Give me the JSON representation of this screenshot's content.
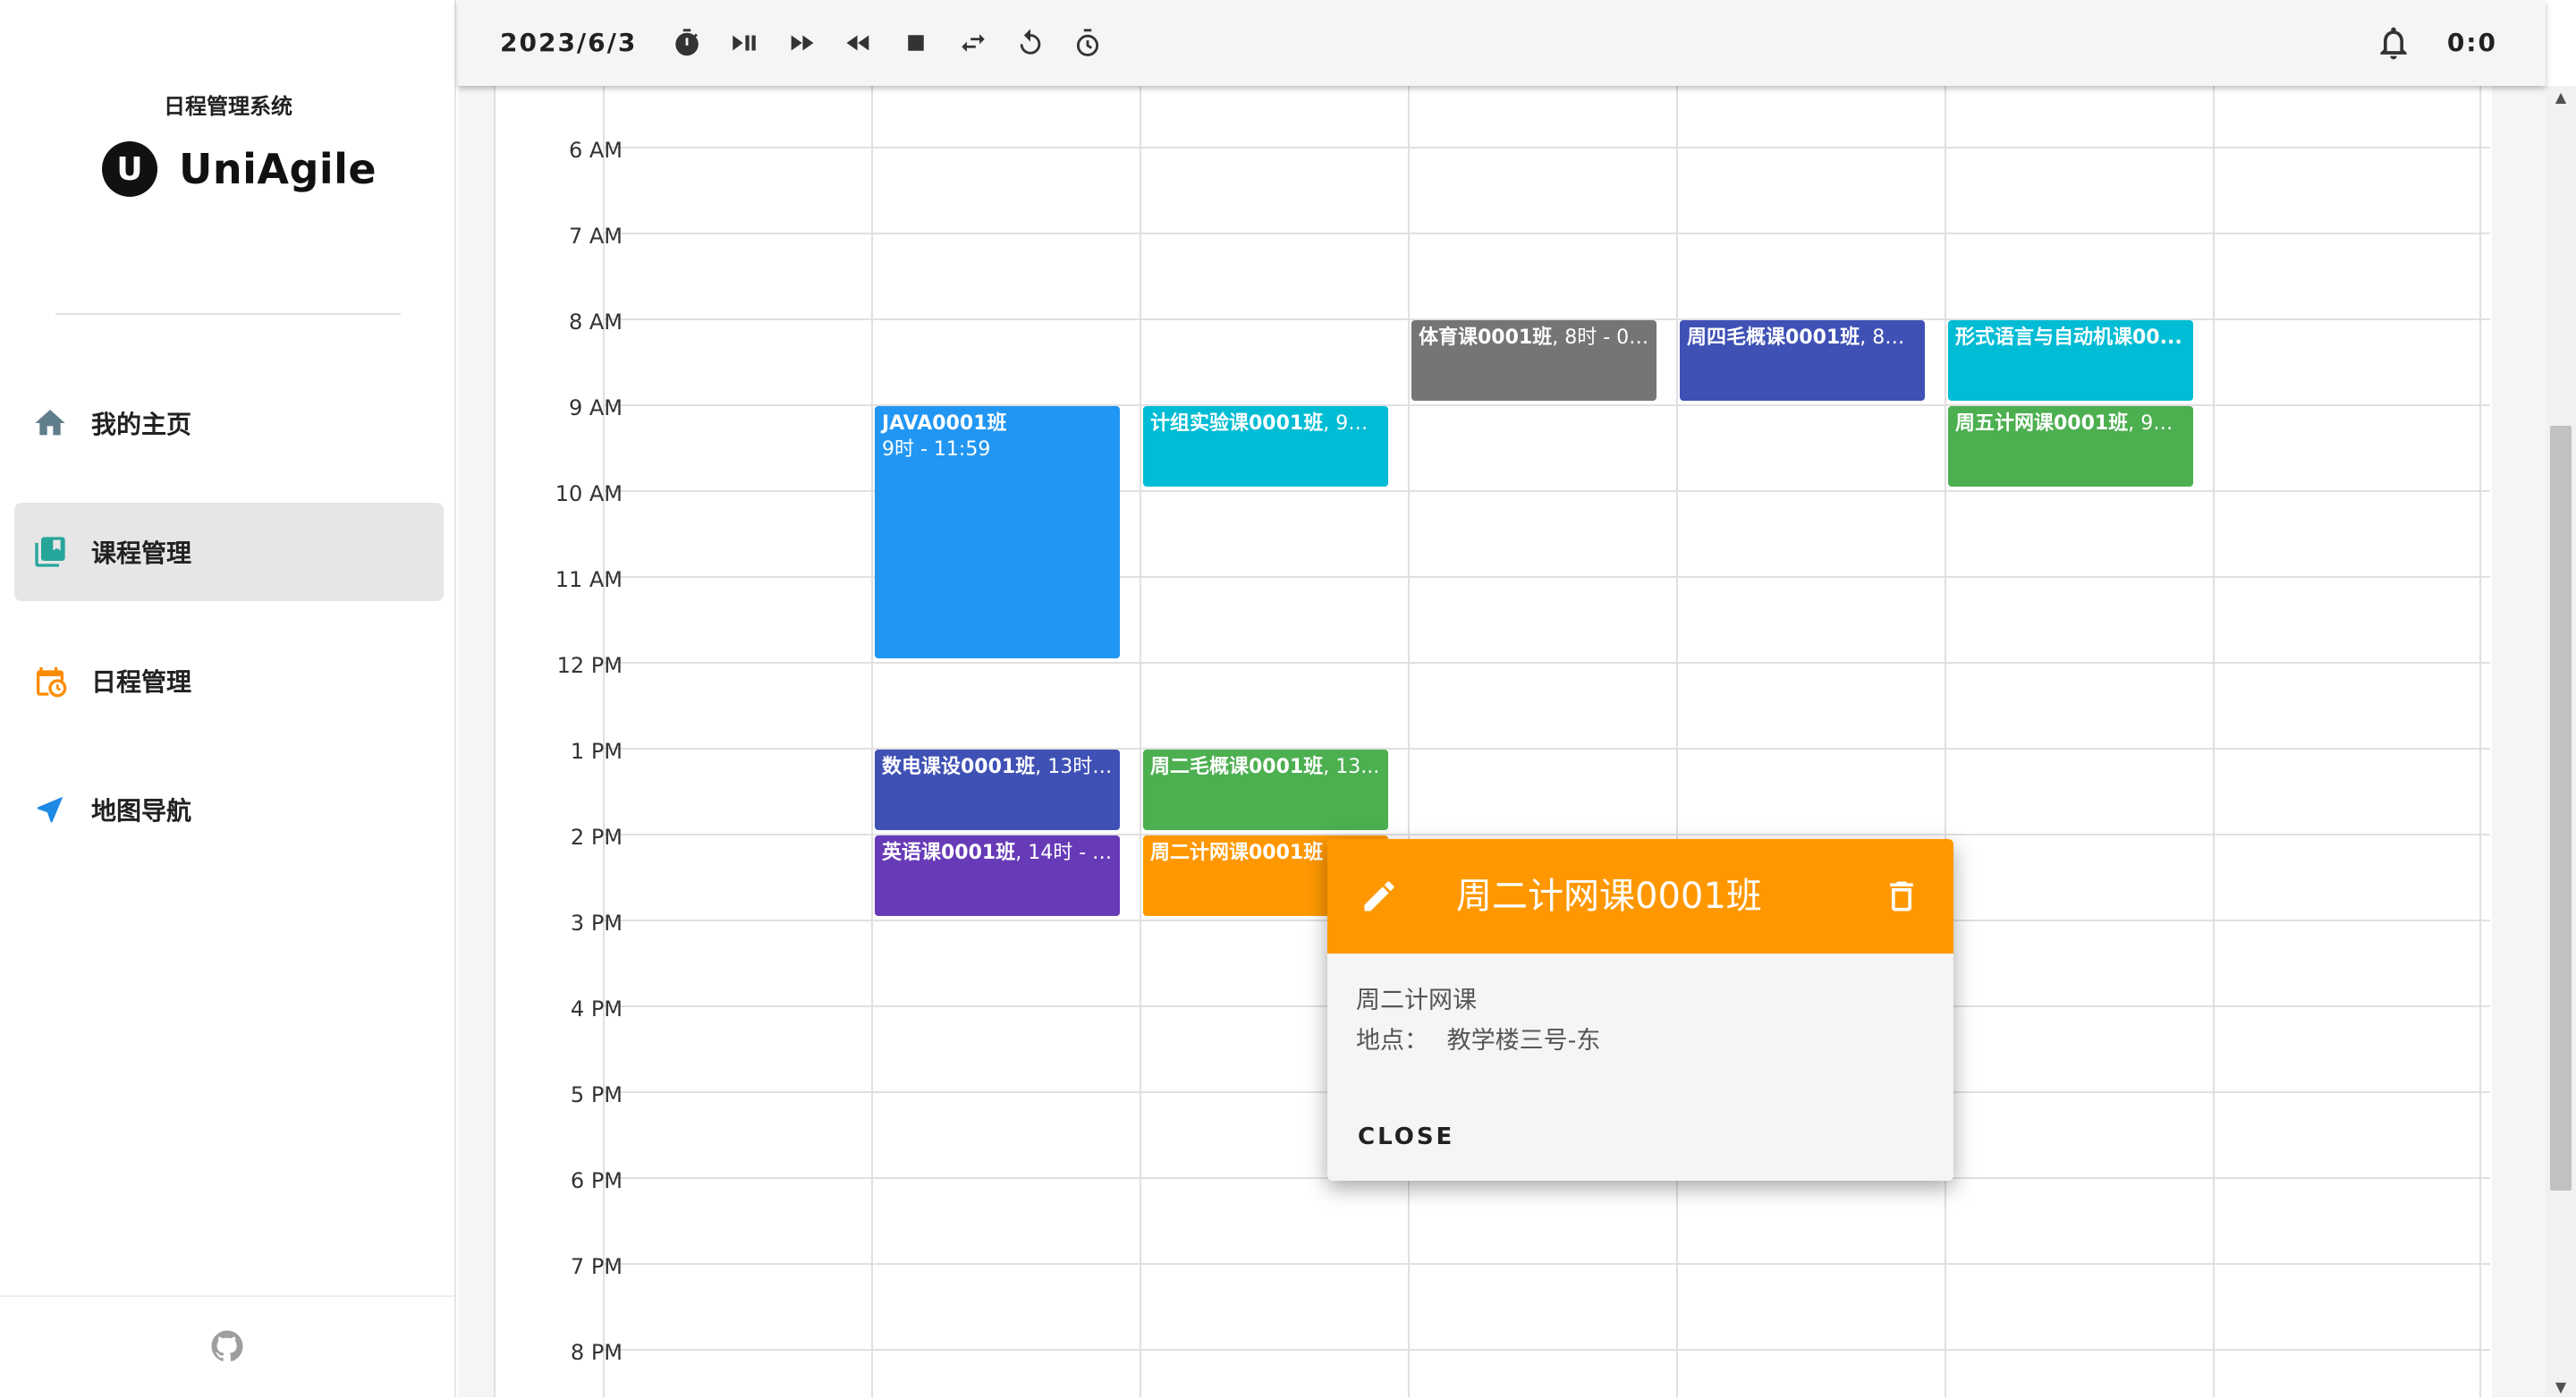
{
  "sidebar": {
    "subtitle": "日程管理系统",
    "logo_letter": "U",
    "brand": "UniAgile",
    "items": [
      {
        "label": "我的主页",
        "icon": "home-icon",
        "active": false
      },
      {
        "label": "课程管理",
        "icon": "book-icon",
        "active": true
      },
      {
        "label": "日程管理",
        "icon": "calendar-clock-icon",
        "active": false
      },
      {
        "label": "地图导航",
        "icon": "navigation-arrow-icon",
        "active": false
      }
    ],
    "footer_icon": "github-icon"
  },
  "topbar": {
    "date": "2023/6/3",
    "buttons": [
      "timer-icon",
      "play-pause-icon",
      "fast-forward-icon",
      "rewind-icon",
      "stop-icon",
      "swap-icon",
      "replay-icon",
      "history-icon"
    ],
    "bell_icon": "bell-icon",
    "clock": "0:0"
  },
  "calendar": {
    "hours": [
      "6 AM",
      "7 AM",
      "8 AM",
      "9 AM",
      "10 AM",
      "11 AM",
      "12 PM",
      "1 PM",
      "2 PM",
      "3 PM",
      "4 PM",
      "5 PM",
      "6 PM",
      "7 PM",
      "8 PM"
    ],
    "events": [
      {
        "title": "JAVA0001班",
        "detail": "9时 - 11:59",
        "color": "#2196f3"
      },
      {
        "title": "计组实验课0001班",
        "detail": ", 9时...",
        "color": "#00bcd4"
      },
      {
        "title": "体育课0001班",
        "detail": ", 8时 - 08...",
        "color": "#757575"
      },
      {
        "title": "周四毛概课0001班",
        "detail": ", 8时...",
        "color": "#3f51b5"
      },
      {
        "title": "形式语言与自动机课00...",
        "detail": "",
        "color": "#00bcd4"
      },
      {
        "title": "周五计网课0001班",
        "detail": ", 9时...",
        "color": "#4caf50"
      },
      {
        "title": "数电课设0001班",
        "detail": ", 13时 -...",
        "color": "#3f51b5"
      },
      {
        "title": "周二毛概课0001班",
        "detail": ", 13...",
        "color": "#4caf50"
      },
      {
        "title": "英语课0001班",
        "detail": ", 14时 - 1...",
        "color": "#673ab7"
      },
      {
        "title": "周二计网课0001班",
        "detail": "",
        "color": "#ff9800"
      }
    ]
  },
  "popup": {
    "title": "周二计网课0001班",
    "description": "周二计网课",
    "location_label": "地点：",
    "location": "教学楼三号-东",
    "close_label": "CLOSE",
    "header_color": "#ff9800"
  }
}
